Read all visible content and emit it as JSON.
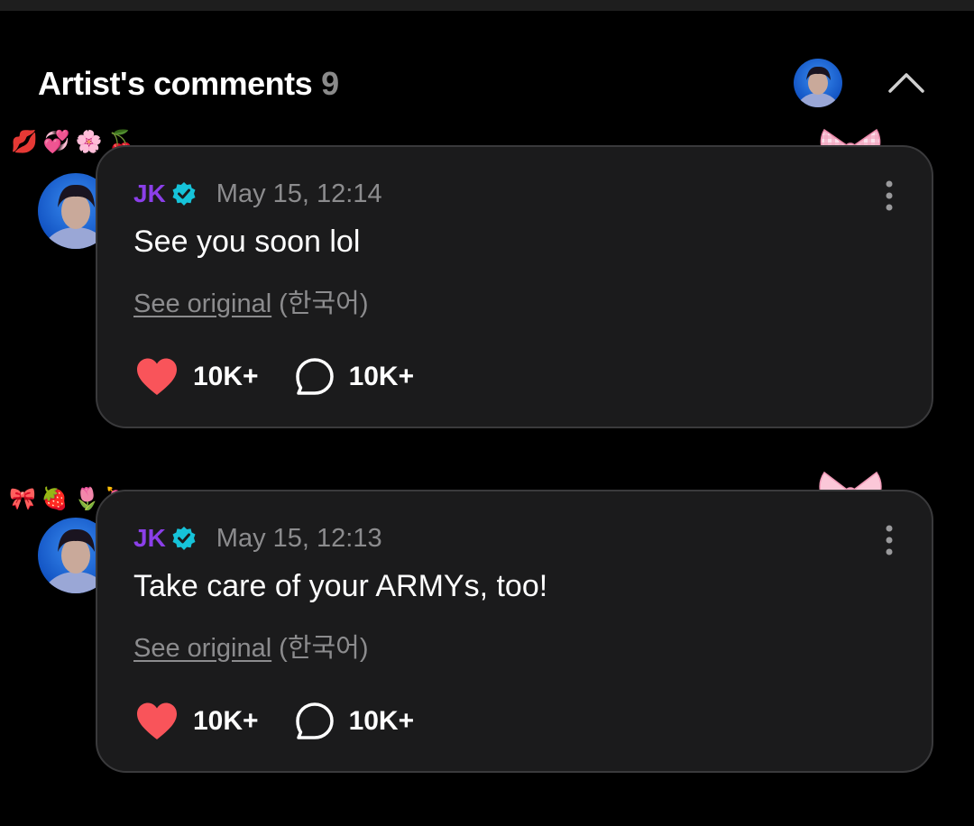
{
  "header": {
    "title": "Artist's comments",
    "count": "9",
    "collapse_icon": "chevron-up-icon"
  },
  "colors": {
    "background": "#000000",
    "card_background": "#1b1b1c",
    "card_border": "#3a3a3c",
    "author_name": "#8b3fe9",
    "verified_badge": "#16c3d9",
    "muted_text": "#8c8c8e",
    "like_heart": "#f9545a"
  },
  "comments": [
    {
      "author": "JK",
      "verified_icon": "verified-badge-icon",
      "timestamp": "May 15, 12:14",
      "text": "See you soon lol",
      "see_original": "See original",
      "language": "(한국어)",
      "likes": "10K+",
      "replies": "10K+",
      "decor_emojis": [
        "💋",
        "💞",
        "🌸",
        "🍒"
      ]
    },
    {
      "author": "JK",
      "verified_icon": "verified-badge-icon",
      "timestamp": "May 15, 12:13",
      "text": "Take care of your ARMYs, too!",
      "see_original": "See original",
      "language": "(한국어)",
      "likes": "10K+",
      "replies": "10K+",
      "decor_emojis": [
        "🎀",
        "🍓",
        "🌷",
        "💘"
      ]
    }
  ]
}
